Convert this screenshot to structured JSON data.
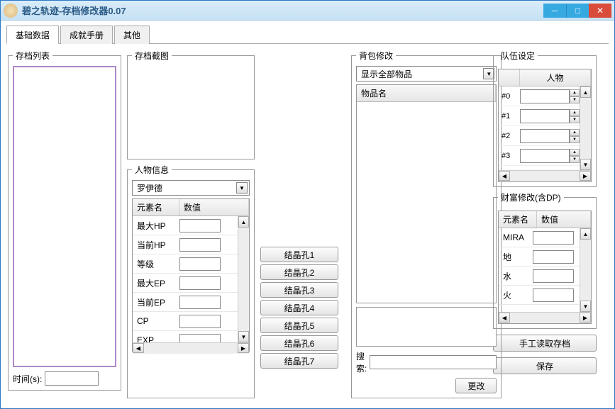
{
  "window": {
    "title": "碧之轨迹-存档修改器0.07"
  },
  "tabs": [
    "基础数据",
    "成就手册",
    "其他"
  ],
  "savelist": {
    "legend": "存档列表",
    "time_label": "时间(s):",
    "time_value": ""
  },
  "screenshot": {
    "legend": "存档截图"
  },
  "charinfo": {
    "legend": "人物信息",
    "selected": "罗伊德",
    "cols": [
      "元素名",
      "数值"
    ],
    "rows": [
      {
        "name": "最大HP",
        "val": ""
      },
      {
        "name": "当前HP",
        "val": ""
      },
      {
        "name": "等级",
        "val": ""
      },
      {
        "name": "最大EP",
        "val": ""
      },
      {
        "name": "当前EP",
        "val": ""
      },
      {
        "name": "CP",
        "val": ""
      },
      {
        "name": "EXP",
        "val": ""
      }
    ]
  },
  "slots": [
    "结晶孔1",
    "结晶孔2",
    "结晶孔3",
    "结晶孔4",
    "结晶孔5",
    "结晶孔6",
    "结晶孔7"
  ],
  "bag": {
    "legend": "背包修改",
    "filter": "显示全部物品",
    "col": "物品名",
    "search_label": "搜索:",
    "search_value": "",
    "change_btn": "更改"
  },
  "party": {
    "legend": "队伍设定",
    "col": "人物",
    "rows": [
      "#0",
      "#1",
      "#2",
      "#3"
    ]
  },
  "wealth": {
    "legend": "财富修改(含DP)",
    "cols": [
      "元素名",
      "数值"
    ],
    "rows": [
      {
        "name": "MIRA",
        "val": ""
      },
      {
        "name": "地",
        "val": ""
      },
      {
        "name": "水",
        "val": ""
      },
      {
        "name": "火",
        "val": ""
      }
    ]
  },
  "buttons": {
    "load": "手工读取存档",
    "save": "保存"
  }
}
